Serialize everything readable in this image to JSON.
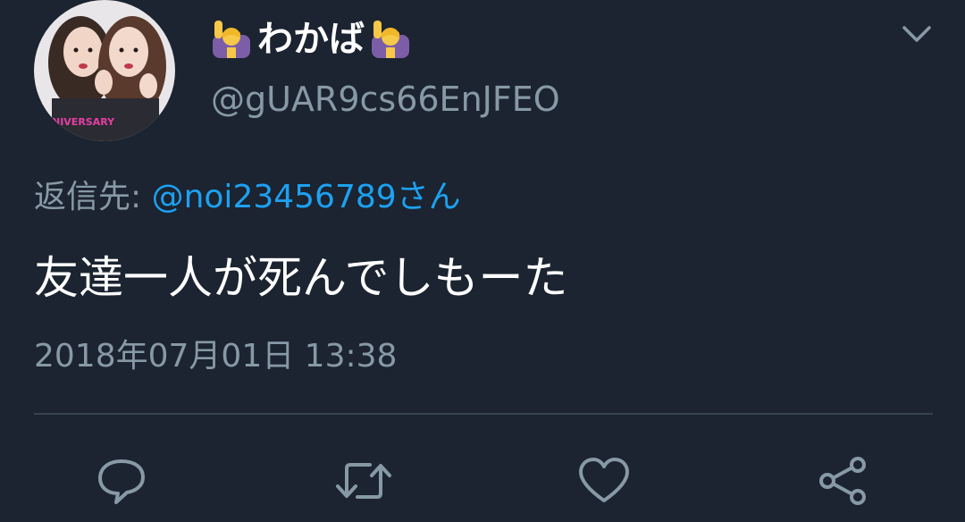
{
  "user": {
    "display_name": "わかば",
    "handle": "@gUAR9cs66EnJFEO",
    "avatar_caption": "NIVERSARY",
    "name_emoji_icon": "person-raising-hand-icon"
  },
  "reply": {
    "label": "返信先:",
    "mention": "@noi23456789さん"
  },
  "tweet": {
    "text": "友達一人が死んでしもーた",
    "timestamp": "2018年07月01日 13:38"
  },
  "header": {
    "menu_icon": "chevron-down-icon"
  },
  "actions": [
    {
      "name": "reply",
      "icon": "comment-bubble-icon"
    },
    {
      "name": "retweet",
      "icon": "retweet-icon"
    },
    {
      "name": "like",
      "icon": "heart-icon"
    },
    {
      "name": "share",
      "icon": "share-icon"
    }
  ],
  "colors": {
    "background": "#1b2430",
    "text": "#ffffff",
    "secondary_text": "#8899a6",
    "link": "#1da1f2",
    "divider": "#38444d"
  }
}
